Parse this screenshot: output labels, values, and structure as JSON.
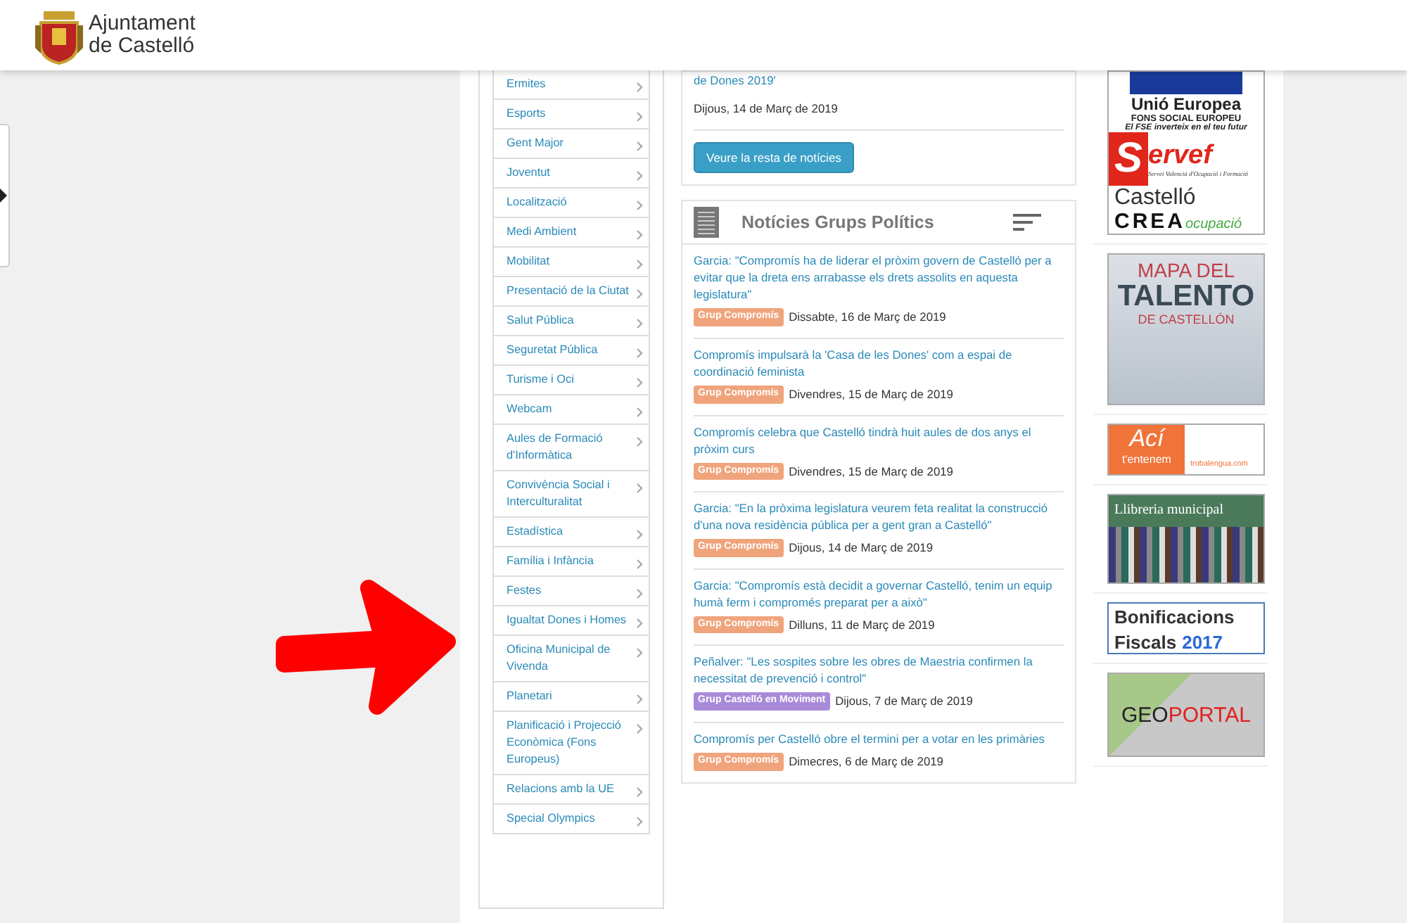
{
  "header": {
    "logo_lines": [
      "Ajuntament",
      "de Castelló"
    ]
  },
  "menu": [
    {
      "label": "Ermites"
    },
    {
      "label": "Esports"
    },
    {
      "label": "Gent Major"
    },
    {
      "label": "Joventut"
    },
    {
      "label": "Localització"
    },
    {
      "label": "Medi Ambient"
    },
    {
      "label": "Mobilitat"
    },
    {
      "label": "Presentació de la Ciutat"
    },
    {
      "label": "Salut Pública"
    },
    {
      "label": "Seguretat Pública"
    },
    {
      "label": "Turisme i Oci"
    },
    {
      "label": "Webcam"
    },
    {
      "label": "Aules de Formació d'Informàtica"
    },
    {
      "label": "Convivència Social i Interculturalitat"
    },
    {
      "label": "Estadística"
    },
    {
      "label": "Família i Infància"
    },
    {
      "label": "Festes"
    },
    {
      "label": "Igualtat Dones i Homes"
    },
    {
      "label": "Oficina Municipal de Vivenda"
    },
    {
      "label": "Planetari"
    },
    {
      "label": "Planificació i Projecció Econòmica (Fons Europeus)"
    },
    {
      "label": "Relacions amb la UE"
    },
    {
      "label": "Special Olympics"
    }
  ],
  "news": {
    "last_title": "de Dones 2019'",
    "last_date": "Dijous, 14 de Març de 2019",
    "more_button": "Veure la resta de notícies"
  },
  "political_news": {
    "title": "Notícies Grups Polítics",
    "items": [
      {
        "title": "Garcia: \"Compromís ha de liderar el pròxim govern de Castelló per a evitar que la dreta ens arrabasse els drets assolits en aquesta legislatura\"",
        "group": "Grup Compromís",
        "color": "#f0a47c",
        "date": "Dissabte, 16 de Març de 2019"
      },
      {
        "title": "Compromís impulsarà la 'Casa de les Dones' com a espai de coordinació feminista",
        "group": "Grup Compromís",
        "color": "#f0a47c",
        "date": "Divendres, 15 de Març de 2019"
      },
      {
        "title": "Compromís celebra que Castelló tindrà huit aules de dos anys el pròxim curs",
        "group": "Grup Compromís",
        "color": "#f0a47c",
        "date": "Divendres, 15 de Març de 2019"
      },
      {
        "title": "Garcia: \"En la pròxima legislatura veurem feta realitat la construcció d'una nova residència pública per a gent gran a Castelló\"",
        "group": "Grup Compromís",
        "color": "#f0a47c",
        "date": "Dijous, 14 de Març de 2019"
      },
      {
        "title": "Garcia: \"Compromís està decidit a governar Castelló, tenim un equip humà ferm i compromés preparat per a això\"",
        "group": "Grup Compromís",
        "color": "#f0a47c",
        "date": "Dilluns, 11 de Març de 2019"
      },
      {
        "title": "Peñalver: \"Les sospites sobre les obres de Maestria confirmen la necessitat de prevenció i control\"",
        "group": "Grup Castelló en Moviment",
        "color": "#a98ad8",
        "date": "Dijous, 7 de Març de 2019"
      },
      {
        "title": "Compromís per Castelló obre el termini per a votar en les primàries",
        "group": "Grup Compromís",
        "color": "#f0a47c",
        "date": "Dimecres, 6 de Març de 2019"
      }
    ]
  },
  "banner_groups": [
    [
      {
        "kind": "eu",
        "title": "Unió Europea",
        "subtitle": "FONS SOCIAL EUROPEU",
        "motto": "El FSE inverteix en el teu futur"
      },
      {
        "kind": "servef",
        "initial": "S",
        "rest": "ervef",
        "caption": "Servei Valencià d'Ocupació i Formació"
      },
      {
        "kind": "crea",
        "line1": "Castelló",
        "line2": "CREA",
        "tag": "ocupació"
      }
    ],
    [
      {
        "kind": "talent",
        "line1": "MAPA DEL",
        "line2": "TALENTO",
        "line3": "DE CASTELLÓN"
      }
    ],
    [
      {
        "kind": "aci",
        "line1": "Ací",
        "line2": "t'entenem",
        "tag": "trobalengua.com"
      }
    ],
    [
      {
        "kind": "library",
        "line1": "Llibreria municipal"
      }
    ],
    [
      {
        "kind": "bonus",
        "line1": "Bonificacions",
        "line2": "Fiscals",
        "year": "2017"
      }
    ],
    [
      {
        "kind": "geo",
        "line1": "GEO",
        "line2": "PORTAL"
      }
    ]
  ]
}
